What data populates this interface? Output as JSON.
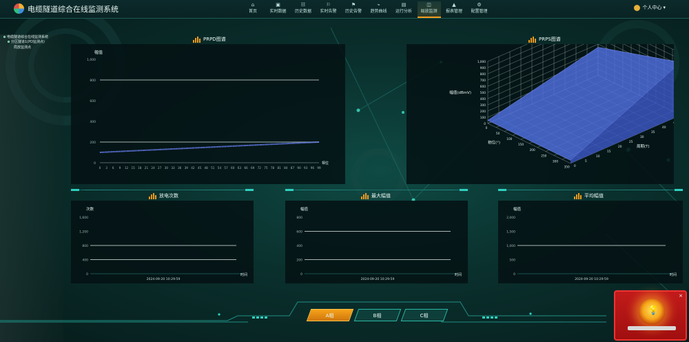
{
  "app": {
    "title": "电缆隧道综合在线监测系统"
  },
  "nav": {
    "items": [
      {
        "label": "首页",
        "icon": "⌂",
        "icon_name": "home-icon"
      },
      {
        "label": "实时数据",
        "icon": "▣",
        "icon_name": "monitor-icon"
      },
      {
        "label": "历史数据",
        "icon": "☷",
        "icon_name": "history-icon"
      },
      {
        "label": "实时告警",
        "icon": "⚐",
        "icon_name": "alarm-bell-icon"
      },
      {
        "label": "历史告警",
        "icon": "⚑",
        "icon_name": "alarm-history-icon"
      },
      {
        "label": "趋势曲线",
        "icon": "⌁",
        "icon_name": "trend-icon"
      },
      {
        "label": "运行分析",
        "icon": "▤",
        "icon_name": "analysis-icon"
      },
      {
        "label": "局放监测",
        "icon": "◫",
        "icon_name": "pd-monitor-icon"
      },
      {
        "label": "报表管理",
        "icon": "▲",
        "icon_name": "report-icon"
      },
      {
        "label": "配置管理",
        "icon": "⚙",
        "icon_name": "settings-icon"
      }
    ],
    "active_index": 7
  },
  "user": {
    "label": "个人中心"
  },
  "tree": {
    "items": [
      "电缆隧道综合在线监测系统",
      "分区隧道1(PD监测点)",
      "局放监测点"
    ]
  },
  "prpd": {
    "title": "PRPD图谱",
    "chart_data": {
      "type": "line",
      "ylabel": "幅值",
      "xlabel": "相位",
      "ylim": [
        0,
        1000
      ],
      "yticks": [
        0,
        200,
        400,
        600,
        800,
        1000
      ],
      "yticklabels": [
        "0",
        "200",
        "400",
        "600",
        "800",
        "1,000"
      ],
      "xticks": [
        0,
        3,
        6,
        9,
        12,
        15,
        18,
        21,
        24,
        27,
        30,
        33,
        36,
        39,
        42,
        45,
        48,
        51,
        54,
        57,
        60,
        63,
        66,
        69,
        72,
        75,
        78,
        81,
        84,
        87,
        90,
        93,
        96,
        99
      ],
      "xlim": [
        0,
        99
      ],
      "series": [
        {
          "x": [
            0,
            99
          ],
          "y": [
            100,
            200
          ]
        }
      ],
      "grid": true,
      "hlines": [
        200,
        800
      ]
    }
  },
  "prps": {
    "title": "PRPS图谱",
    "chart_data": {
      "type": "surface",
      "zlabel": "幅值(dBmV)",
      "xlabel": "相位(°)",
      "ylabel": "周期(T)",
      "zticks": [
        0,
        100,
        200,
        300,
        400,
        500,
        600,
        700,
        800,
        900,
        1000
      ],
      "zticklabels": [
        "0",
        "100",
        "200",
        "300",
        "400",
        "500",
        "600",
        "700",
        "800",
        "900",
        "1,000"
      ],
      "xticks": [
        0,
        50,
        100,
        150,
        200,
        250,
        300,
        350
      ],
      "yticks": [
        0,
        5,
        10,
        15,
        20,
        25,
        30,
        35,
        40,
        45,
        50
      ]
    }
  },
  "small_charts": [
    {
      "title": "放电次数",
      "chart_data": {
        "type": "line",
        "ylabel": "次数",
        "xlabel": "时间",
        "ylim": [
          0,
          1600
        ],
        "yticks": [
          0,
          400,
          800,
          1200,
          1600
        ],
        "yticklabels": [
          "0",
          "400",
          "800",
          "1,200",
          "1,600"
        ],
        "xticklabels": [
          "2024-09-20 10:29:59"
        ],
        "hlines": [
          400,
          800
        ]
      }
    },
    {
      "title": "最大幅值",
      "chart_data": {
        "type": "line",
        "ylabel": "幅值",
        "xlabel": "时间",
        "ylim": [
          0,
          800
        ],
        "yticks": [
          0,
          200,
          400,
          600,
          800
        ],
        "yticklabels": [
          "0",
          "200",
          "400",
          "600",
          "800"
        ],
        "xticklabels": [
          "2024-09-20 10:29:59"
        ],
        "hlines": [
          200,
          600
        ]
      }
    },
    {
      "title": "平均幅值",
      "chart_data": {
        "type": "line",
        "ylabel": "幅值",
        "xlabel": "时间",
        "ylim": [
          0,
          2000
        ],
        "yticks": [
          0,
          500,
          1000,
          1500,
          2000
        ],
        "yticklabels": [
          "0",
          "500",
          "1,000",
          "1,500",
          "2,000"
        ],
        "xticklabels": [
          "2024-09-20 10:29:59"
        ],
        "hlines": [
          1000
        ]
      }
    }
  ],
  "phases": [
    {
      "label": "A相",
      "active": true
    },
    {
      "label": "B相",
      "active": false
    },
    {
      "label": "C相",
      "active": false
    }
  ],
  "alarm": {
    "close": "×"
  },
  "colors": {
    "accent": "#f29b1d",
    "teal": "#2bb8a7",
    "line": "#6f86ff"
  }
}
